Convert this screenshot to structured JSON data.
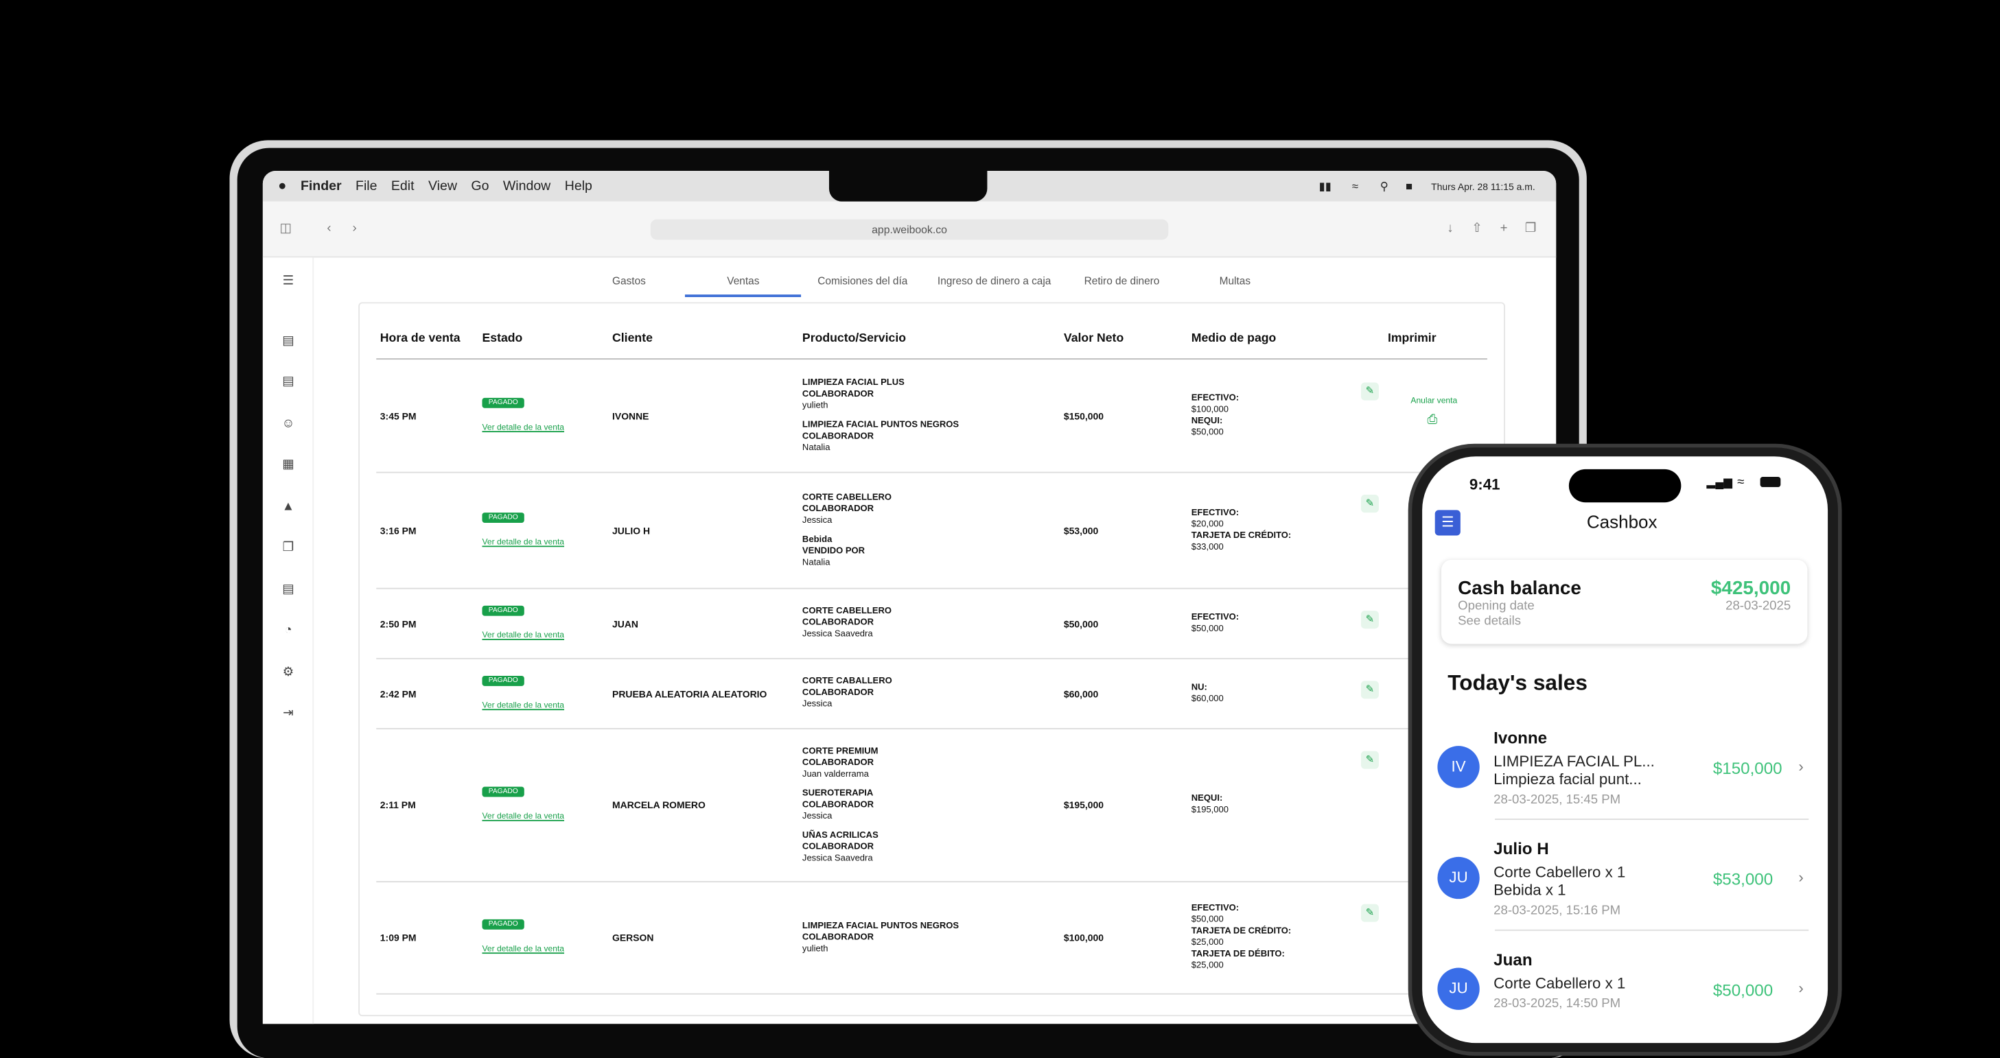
{
  "menubar": {
    "app": "Finder",
    "items": [
      "File",
      "Edit",
      "View",
      "Go",
      "Window",
      "Help"
    ],
    "datetime": "Thurs Apr. 28 11:15 a.m."
  },
  "browser": {
    "url": "app.weibook.co"
  },
  "tabs": [
    "Gastos",
    "Ventas",
    "Comisiones del día",
    "Ingreso de dinero a caja",
    "Retiro de dinero",
    "Multas"
  ],
  "active_tab": "Ventas",
  "table": {
    "headers": [
      "Hora de venta",
      "Estado",
      "Cliente",
      "Producto/Servicio",
      "Valor Neto",
      "Medio de pago",
      "Imprimir"
    ],
    "status_label": "PAGADO",
    "detail_link": "Ver detalle de la venta",
    "cancel_label": "Anular venta",
    "rows": [
      {
        "time": "3:45 PM",
        "client": "IVONNE",
        "products": [
          {
            "name": "LIMPIEZA FACIAL PLUS",
            "role": "COLABORADOR",
            "person": "yulieth"
          },
          {
            "name": "LIMPIEZA FACIAL PUNTOS NEGROS",
            "role": "COLABORADOR",
            "person": "Natalia"
          }
        ],
        "value": "$150,000",
        "payments": [
          {
            "method": "EFECTIVO:",
            "amount": "$100,000"
          },
          {
            "method": "NEQUI:",
            "amount": "$50,000"
          }
        ]
      },
      {
        "time": "3:16 PM",
        "client": "JULIO H",
        "products": [
          {
            "name": "CORTE CABELLERO",
            "role": "COLABORADOR",
            "person": "Jessica"
          },
          {
            "name": "Bebida",
            "role": "VENDIDO POR",
            "person": "Natalia"
          }
        ],
        "value": "$53,000",
        "payments": [
          {
            "method": "EFECTIVO:",
            "amount": "$20,000"
          },
          {
            "method": "TARJETA DE CRÉDITO:",
            "amount": "$33,000"
          }
        ]
      },
      {
        "time": "2:50 PM",
        "client": "JUAN",
        "products": [
          {
            "name": "CORTE CABELLERO",
            "role": "COLABORADOR",
            "person": "Jessica Saavedra"
          }
        ],
        "value": "$50,000",
        "payments": [
          {
            "method": "EFECTIVO:",
            "amount": "$50,000"
          }
        ]
      },
      {
        "time": "2:42 PM",
        "client": "PRUEBA ALEATORIA ALEATORIO",
        "products": [
          {
            "name": "CORTE CABALLERO",
            "role": "COLABORADOR",
            "person": "Jessica"
          }
        ],
        "value": "$60,000",
        "payments": [
          {
            "method": "NU:",
            "amount": "$60,000"
          }
        ]
      },
      {
        "time": "2:11 PM",
        "client": "MARCELA ROMERO",
        "products": [
          {
            "name": "CORTE PREMIUM",
            "role": "COLABORADOR",
            "person": "Juan valderrama"
          },
          {
            "name": "SUEROTERAPIA",
            "role": "COLABORADOR",
            "person": "Jessica"
          },
          {
            "name": "UÑAS ACRILICAS",
            "role": "COLABORADOR",
            "person": "Jessica Saavedra"
          }
        ],
        "value": "$195,000",
        "payments": [
          {
            "method": "NEQUI:",
            "amount": "$195,000"
          }
        ]
      },
      {
        "time": "1:09 PM",
        "client": "GERSON",
        "products": [
          {
            "name": "LIMPIEZA FACIAL PUNTOS NEGROS",
            "role": "COLABORADOR",
            "person": "yulieth"
          }
        ],
        "value": "$100,000",
        "payments": [
          {
            "method": "EFECTIVO:",
            "amount": "$50,000"
          },
          {
            "method": "TARJETA DE CRÉDITO:",
            "amount": "$25,000"
          },
          {
            "method": "TARJETA DE DÉBITO:",
            "amount": "$25,000"
          }
        ]
      }
    ]
  },
  "phone": {
    "time": "9:41",
    "title": "Cashbox",
    "balance": {
      "label": "Cash balance",
      "amount": "$425,000",
      "opening_label": "Opening date",
      "opening_date": "28-03-2025",
      "details": "See details"
    },
    "sales_title": "Today's sales",
    "sales": [
      {
        "initials": "IV",
        "name": "Ivonne",
        "lines": [
          "LIMPIEZA FACIAL PL...",
          "Limpieza facial punt..."
        ],
        "amount": "$150,000",
        "date": "28-03-2025, 15:45 PM"
      },
      {
        "initials": "JU",
        "name": "Julio H",
        "lines": [
          "Corte Cabellero x 1",
          "Bebida x 1"
        ],
        "amount": "$53,000",
        "date": "28-03-2025, 15:16 PM"
      },
      {
        "initials": "JU",
        "name": "Juan",
        "lines": [
          "Corte Cabellero x 1"
        ],
        "amount": "$50,000",
        "date": "28-03-2025, 14:50 PM"
      }
    ]
  },
  "colors": {
    "accent": "#18a04a",
    "tab_underline": "#3d6fd6",
    "avatar": "#3a6ee8",
    "phone_amount": "#3ec27a"
  }
}
